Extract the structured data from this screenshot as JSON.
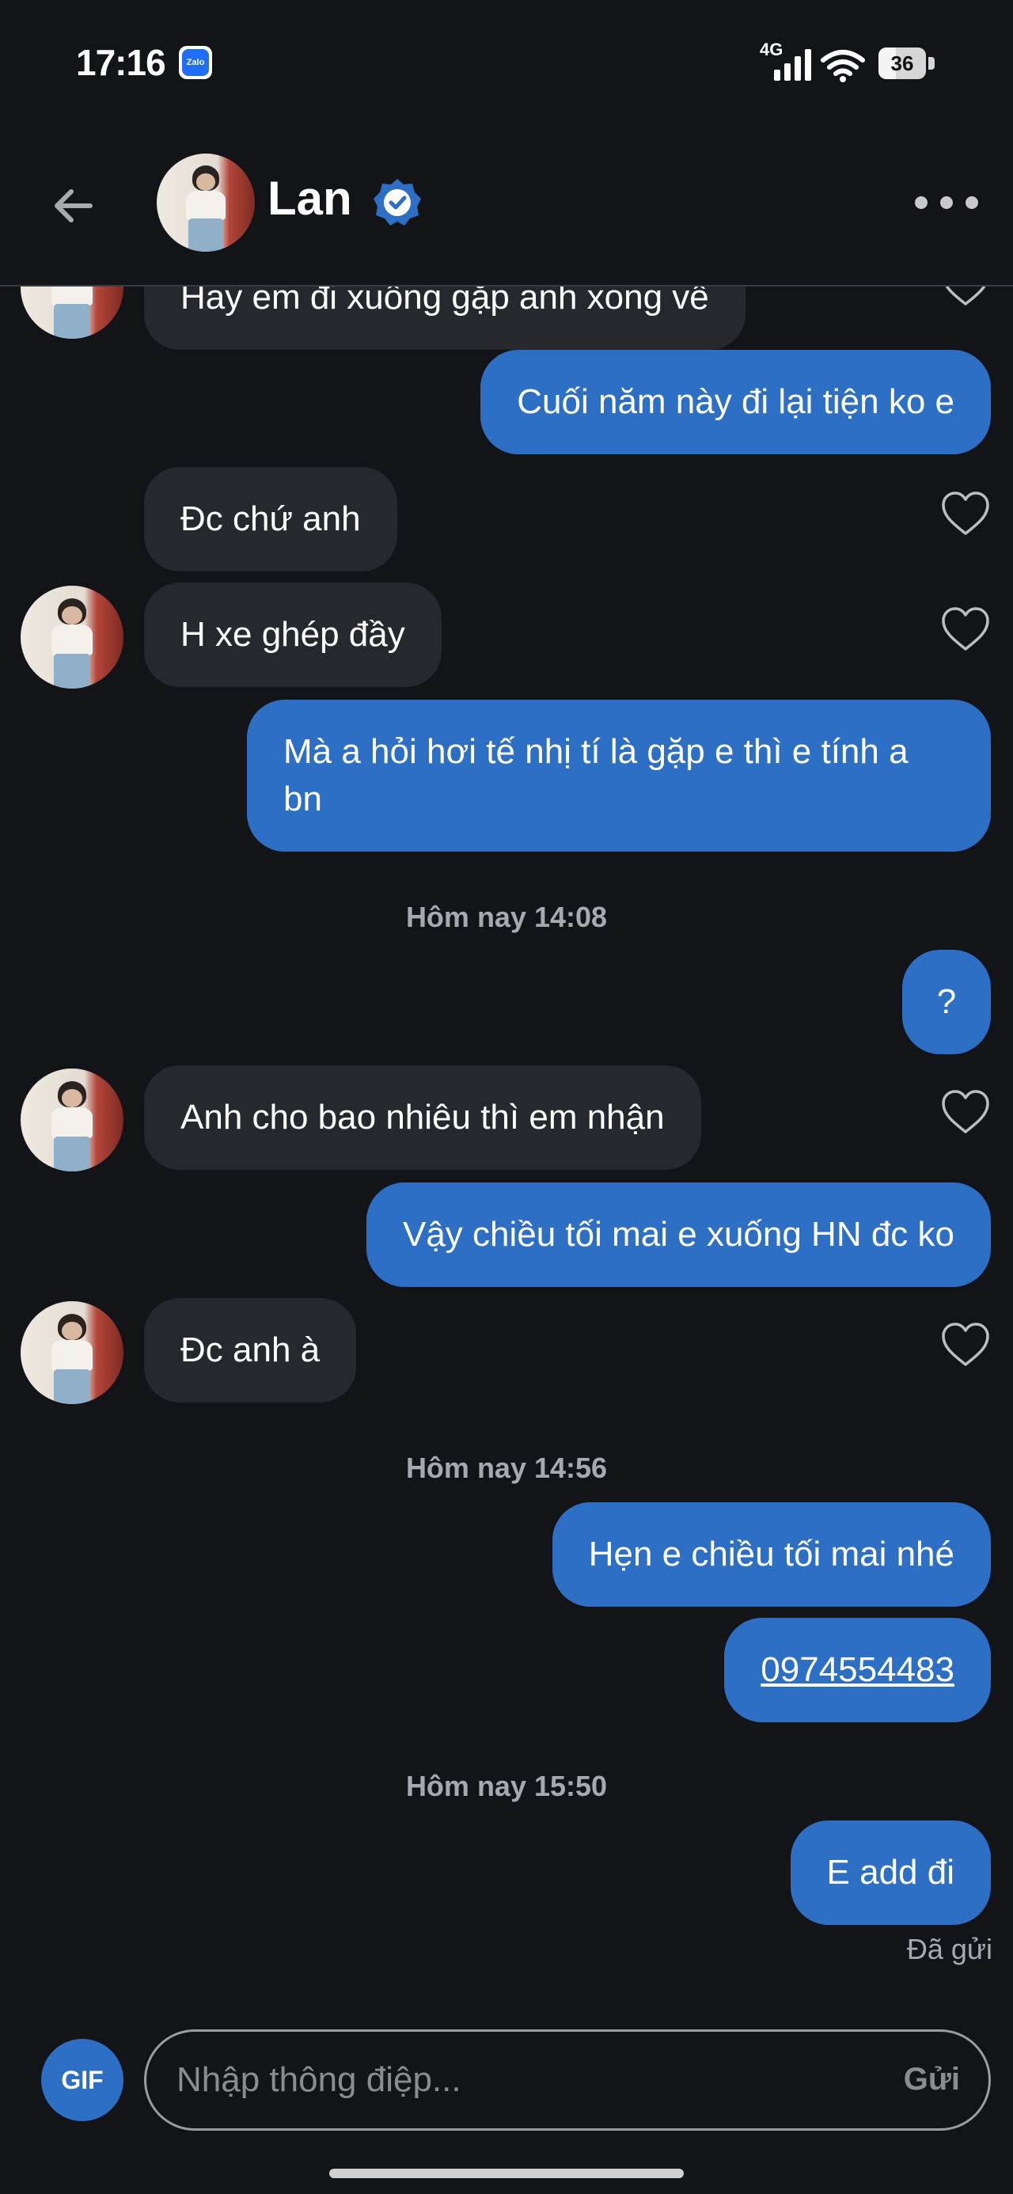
{
  "status_bar": {
    "time": "17:16",
    "app_badge": "Zalo",
    "network": "4G",
    "battery": "36"
  },
  "header": {
    "contact_name": "Lan"
  },
  "messages": [
    {
      "side": "in",
      "text": "Hay em đi xuống gặp anh xong về"
    },
    {
      "side": "out",
      "text": "Cuối năm này đi lại tiện ko e"
    },
    {
      "side": "in",
      "text": "Đc chứ anh"
    },
    {
      "side": "in",
      "text": "H xe ghép đầy"
    },
    {
      "side": "out",
      "text": "Mà a hỏi hơi tế nhị tí là gặp e thì e tính a bn"
    },
    {
      "side": "out",
      "text": "?"
    },
    {
      "side": "in",
      "text": "Anh cho bao nhiêu thì em nhận"
    },
    {
      "side": "out",
      "text": "Vậy chiều tối mai e xuống HN đc ko"
    },
    {
      "side": "in",
      "text": "Đc anh à"
    },
    {
      "side": "out",
      "text": "Hẹn e chiều tối mai nhé"
    },
    {
      "side": "out",
      "text": "0974554483"
    },
    {
      "side": "out",
      "text": "E add đi"
    }
  ],
  "timestamps": [
    "Hôm nay 14:08",
    "Hôm nay 14:56",
    "Hôm nay 15:50"
  ],
  "sent_status": "Đã gửi",
  "composer": {
    "gif_label": "GIF",
    "placeholder": "Nhập thông điệp...",
    "send_label": "Gửi"
  },
  "colors": {
    "background": "#131418",
    "incoming_bubble": "#26282d",
    "outgoing_bubble": "#2d6fc4",
    "verified_badge": "#2d6fc4"
  }
}
